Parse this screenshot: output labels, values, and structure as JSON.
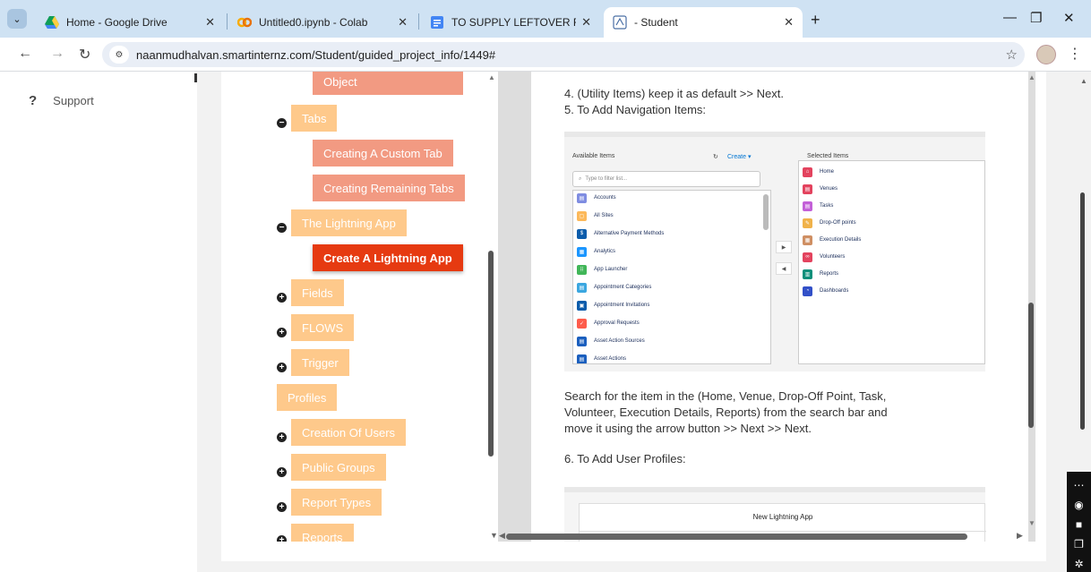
{
  "browser": {
    "tabs": [
      {
        "title": "Home - Google Drive",
        "active": false
      },
      {
        "title": "Untitled0.ipynb - Colab",
        "active": false
      },
      {
        "title": "TO SUPPLY LEFTOVER FOOD TO",
        "active": false
      },
      {
        "title": "- Student",
        "active": true
      }
    ],
    "url": "naanmudhalvan.smartinternz.com/Student/guided_project_info/1449#"
  },
  "sidebar": {
    "support_label": "Support"
  },
  "tree": {
    "items": [
      {
        "label": "Object",
        "style": "salmon"
      },
      {
        "label": "Tabs",
        "style": "light",
        "toggle": "minus"
      },
      {
        "label": "Creating A Custom Tab",
        "style": "salmon"
      },
      {
        "label": "Creating Remaining Tabs",
        "style": "salmon"
      },
      {
        "label": "The Lightning App",
        "style": "light",
        "toggle": "minus"
      },
      {
        "label": "Create A Lightning App",
        "style": "active"
      },
      {
        "label": "Fields",
        "style": "light",
        "toggle": "plus"
      },
      {
        "label": "FLOWS",
        "style": "light",
        "toggle": "plus"
      },
      {
        "label": "Trigger",
        "style": "light",
        "toggle": "plus"
      },
      {
        "label": "Profiles",
        "style": "light"
      },
      {
        "label": "Creation Of Users",
        "style": "light",
        "toggle": "plus"
      },
      {
        "label": "Public Groups",
        "style": "light",
        "toggle": "plus"
      },
      {
        "label": "Report Types",
        "style": "light",
        "toggle": "plus"
      },
      {
        "label": "Reports",
        "style": "light",
        "toggle": "plus"
      }
    ]
  },
  "doc": {
    "step4": "4. (Utility Items) keep it as default >> Next.",
    "step5": "5. To Add Navigation Items:",
    "instructions_line1": "Search for the item in the (Home, Venue, Drop-Off Point, Task,",
    "instructions_line2": "Volunteer, Execution Details, Reports) from the search bar and",
    "instructions_line3": "move it using the arrow button >> Next >> Next.",
    "step6": "6. To Add User Profiles:"
  },
  "nav_screenshot": {
    "available_label": "Available Items",
    "create_label": "Create ▾",
    "filter_placeholder": "Type to filter list...",
    "selected_label": "Selected Items",
    "available_items": [
      {
        "label": "Accounts",
        "color": "#7f8de1"
      },
      {
        "label": "All Sites",
        "color": "#fcb95b"
      },
      {
        "label": "Alternative Payment Methods",
        "color": "#0b5cab"
      },
      {
        "label": "Analytics",
        "color": "#1b96ff"
      },
      {
        "label": "App Launcher",
        "color": "#41b658"
      },
      {
        "label": "Appointment Categories",
        "color": "#3ba7e0"
      },
      {
        "label": "Appointment Invitations",
        "color": "#0b5cab"
      },
      {
        "label": "Approval Requests",
        "color": "#fe5c4c"
      },
      {
        "label": "Asset Action Sources",
        "color": "#1b5fbe"
      },
      {
        "label": "Asset Actions",
        "color": "#1b5fbe"
      }
    ],
    "selected_items": [
      {
        "label": "Home",
        "color": "#e3435e"
      },
      {
        "label": "Venues",
        "color": "#e3435e"
      },
      {
        "label": "Tasks",
        "color": "#c360d8"
      },
      {
        "label": "Drop-Off points",
        "color": "#f0b24a"
      },
      {
        "label": "Execution Details",
        "color": "#cf8f63"
      },
      {
        "label": "Volunteers",
        "color": "#e3435e"
      },
      {
        "label": "Reports",
        "color": "#0c8f7a"
      },
      {
        "label": "Dashboards",
        "color": "#3250c8"
      }
    ]
  },
  "profile_screenshot": {
    "title": "New Lightning App"
  }
}
